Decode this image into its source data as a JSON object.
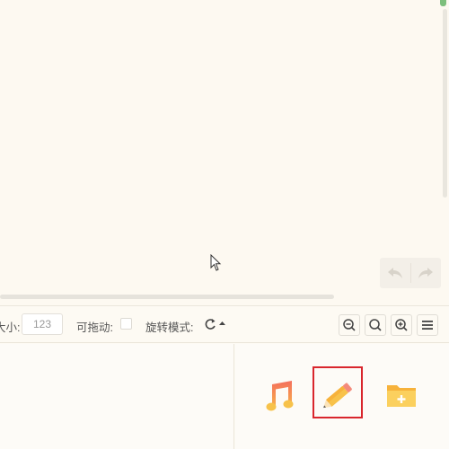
{
  "toolbar": {
    "size_label": "大小:",
    "size_value": "123",
    "draggable_label": "可拖动:",
    "rotate_label": "旋转模式:"
  },
  "icons": {
    "undo": "undo-icon",
    "redo": "redo-icon",
    "rotate": "rotate-icon",
    "zoom_out": "zoom-out-icon",
    "zoom_reset": "zoom-reset-icon",
    "zoom_in": "zoom-in-icon",
    "menu": "menu-icon",
    "music": "music-icon",
    "pencil": "pencil-icon",
    "folder_add": "folder-add-icon"
  },
  "colors": {
    "background": "#fdf9f1",
    "selection_frame": "#d9262d",
    "music_icon": "#f07a5a",
    "pencil_icon": "#f7b23b",
    "folder_icon": "#f8c24a"
  }
}
